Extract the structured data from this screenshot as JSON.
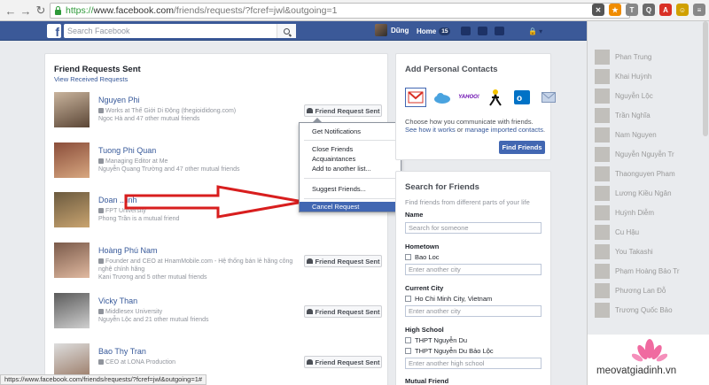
{
  "browser": {
    "url_scheme": "https://",
    "url_host": "www.facebook.com",
    "url_path": "/friends/requests/?fcref=jwl&outgoing=1",
    "status_url": "https://www.facebook.com/friends/requests/?fcref=jwl&outgoing=1#"
  },
  "topbar": {
    "search_placeholder": "Search Facebook",
    "user_name": "Dũng",
    "home_label": "Home",
    "home_count": "15"
  },
  "main": {
    "title": "Friend Requests Sent",
    "view_received": "View Received Requests",
    "request_button": "Friend Request Sent",
    "friends": [
      {
        "name": "Nguyen Phi",
        "info": "Works at Thế Giới Di Động (thegioididong.com)",
        "mutual": "Ngoc Hà and 47 other mutual friends"
      },
      {
        "name": "Tuong Phi Quan",
        "info": "Managing Editor at Me",
        "mutual": "Nguyễn Quang Trường and 47 other mutual friends"
      },
      {
        "name": "Doan ...inh",
        "info": "FPT University",
        "mutual": "Phong Trần is a mutual friend"
      },
      {
        "name": "Hoàng Phú Nam",
        "info": "Founder and CEO at HnamMobile.com - Hệ thống bán lẻ hãng công nghệ chính hãng",
        "mutual": "Kani Trương and 5 other mutual friends"
      },
      {
        "name": "Vicky Than",
        "info": "Middlesex University",
        "mutual": "Nguyễn Lộc and 21 other mutual friends"
      },
      {
        "name": "Bao Thy Tran",
        "info": "CEO at LONA Production",
        "mutual": ""
      }
    ]
  },
  "dropdown": {
    "items": [
      "Get Notifications",
      "Close Friends",
      "Acquaintances",
      "Add to another list...",
      "Suggest Friends...",
      "Cancel Request"
    ]
  },
  "contacts": {
    "title": "Add Personal Contacts",
    "icons": [
      "gmail-icon",
      "cloud-icon",
      "yahoo-icon",
      "aim-icon",
      "outlook-icon",
      "email-icon"
    ],
    "yahoo_text": "YAHOO!",
    "desc_prefix": "Choose how you communicate with friends.",
    "desc_link1": "See how it works",
    "desc_or": "or",
    "desc_link2": "manage imported contacts",
    "button": "Find Friends"
  },
  "search_friends": {
    "title": "Search for Friends",
    "subtitle": "Find friends from different parts of your life",
    "name_label": "Name",
    "name_placeholder": "Search for someone",
    "hometown_label": "Hometown",
    "hometown_option": "Bao Loc",
    "hometown_placeholder": "Enter another city",
    "city_label": "Current City",
    "city_option": "Ho Chi Minh City, Vietnam",
    "city_placeholder": "Enter another city",
    "school_label": "High School",
    "school_option1": "THPT Nguyễn Du",
    "school_option2": "THPT Nguyễn Du Bảo Lộc",
    "school_placeholder": "Enter another high school",
    "mutual_label": "Mutual Friend"
  },
  "chat": {
    "names": [
      "Phan Trung",
      "Khai Huỳnh",
      "Nguyễn Lộc",
      "Trần Nghĩa",
      "Nam Nguyen",
      "Nguyễn Nguyễn Tr",
      "Thaonguyen Pham",
      "Lương Kiều Ngân",
      "Huỳnh Diễm",
      "Cu Hậu",
      "You Takashi",
      "Phạm Hoàng Bảo Tr",
      "Phương Lan Đỗ",
      "Trương Quốc Bảo"
    ]
  },
  "watermark": {
    "text": "meovatgiadinh.vn"
  }
}
